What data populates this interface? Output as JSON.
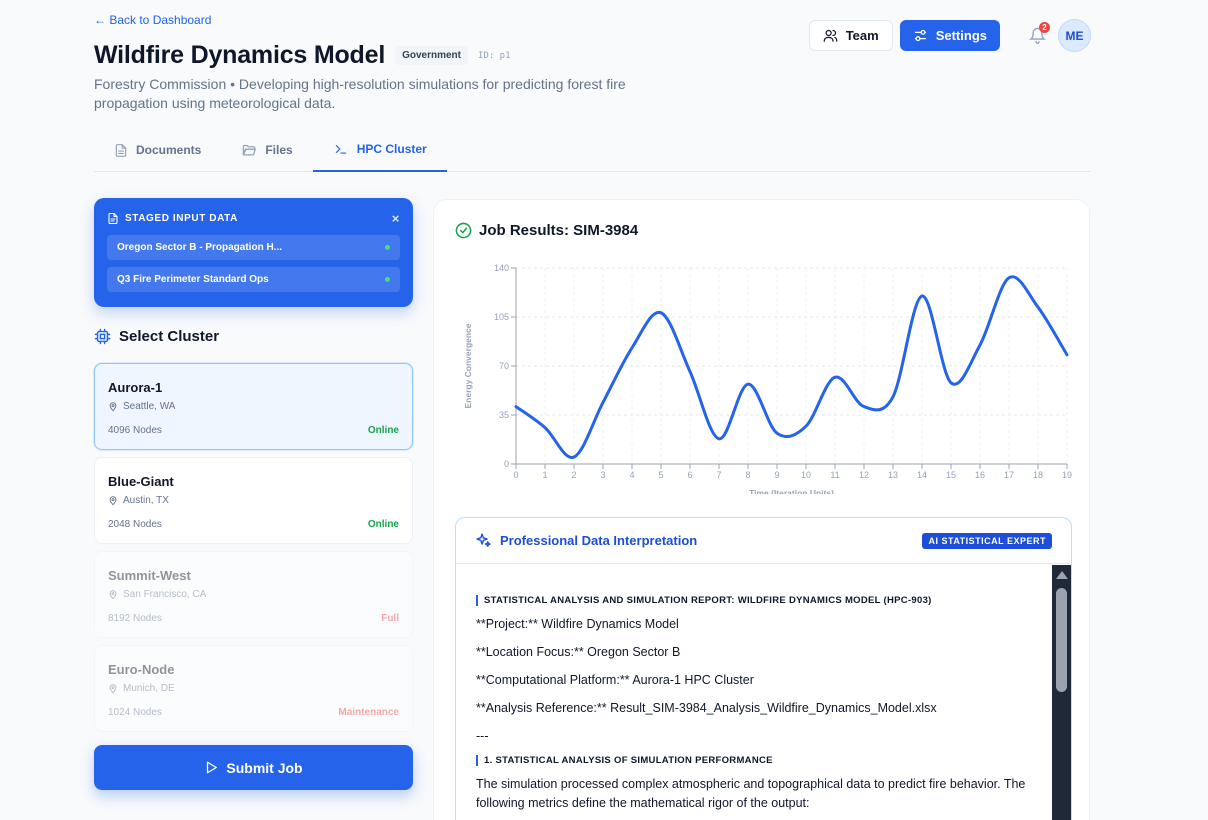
{
  "header": {
    "back_label": "← Back to Dashboard",
    "title": "Wildfire Dynamics Model",
    "badge": "Government",
    "project_id": "ID: p1",
    "subtitle": "Forestry Commission • Developing high-resolution simulations for predicting forest fire propagation using meteorological data.",
    "team_label": "Team",
    "settings_label": "Settings",
    "notification_count": "2",
    "avatar_initials": "ME"
  },
  "tabs": [
    {
      "label": "Documents",
      "icon": "document-icon",
      "active": false
    },
    {
      "label": "Files",
      "icon": "folder-icon",
      "active": false
    },
    {
      "label": "HPC Cluster",
      "icon": "terminal-icon",
      "active": true
    }
  ],
  "staged": {
    "title": "STAGED INPUT DATA",
    "close": "×",
    "items": [
      "Oregon Sector B - Propagation H...",
      "Q3 Fire Perimeter Standard Ops"
    ]
  },
  "clusters_heading": "Select Cluster",
  "clusters": [
    {
      "name": "Aurora-1",
      "location": "Seattle, WA",
      "nodes": "4096 Nodes",
      "status": "Online",
      "status_color": "#16a34a"
    },
    {
      "name": "Blue-Giant",
      "location": "Austin, TX",
      "nodes": "2048 Nodes",
      "status": "Online",
      "status_color": "#16a34a"
    },
    {
      "name": "Summit-West",
      "location": "San Francisco, CA",
      "nodes": "8192 Nodes",
      "status": "Full",
      "status_color": "#ef4444"
    },
    {
      "name": "Euro-Node",
      "location": "Munich, DE",
      "nodes": "1024 Nodes",
      "status": "Maintenance",
      "status_color": "#ef4444"
    }
  ],
  "submit_label": "Submit Job",
  "results": {
    "title": "Job Results: SIM-3984"
  },
  "chart_data": {
    "type": "line",
    "x": [
      0,
      1,
      2,
      3,
      4,
      5,
      6,
      7,
      8,
      9,
      10,
      11,
      12,
      13,
      14,
      15,
      16,
      17,
      18,
      19
    ],
    "series": [
      {
        "values": [
          41,
          26,
          5,
          44,
          83,
          108,
          66,
          18,
          57,
          22,
          27,
          62,
          41,
          48,
          120,
          58,
          85,
          133,
          112,
          78
        ]
      }
    ],
    "xlabel": "Time (Iteration Units)",
    "ylabel": "Energy Convergence",
    "xticks": [
      "0",
      "1",
      "2",
      "3",
      "4",
      "5",
      "6",
      "7",
      "8",
      "9",
      "10",
      "11",
      "12",
      "13",
      "14",
      "15",
      "16",
      "17",
      "18",
      "19"
    ],
    "yticks": [
      "0",
      "35",
      "70",
      "105",
      "140"
    ],
    "ylim": [
      0,
      140
    ],
    "grid": true,
    "line_color": "#2563eb"
  },
  "interpretation": {
    "title": "Professional Data Interpretation",
    "badge": "AI STATISTICAL EXPERT",
    "heading1": "STATISTICAL ANALYSIS AND SIMULATION REPORT: WILDFIRE DYNAMICS MODEL (HPC-903)",
    "lines": [
      "**Project:** Wildfire Dynamics Model",
      "**Location Focus:** Oregon Sector B",
      "**Computational Platform:** Aurora-1 HPC Cluster",
      "**Analysis Reference:** Result_SIM-3984_Analysis_Wildfire_Dynamics_Model.xlsx",
      "---"
    ],
    "heading2": "1. STATISTICAL ANALYSIS OF SIMULATION PERFORMANCE",
    "paragraph": "The simulation processed complex atmospheric and topographical data to predict fire behavior. The following metrics define the mathematical rigor of the output:"
  }
}
